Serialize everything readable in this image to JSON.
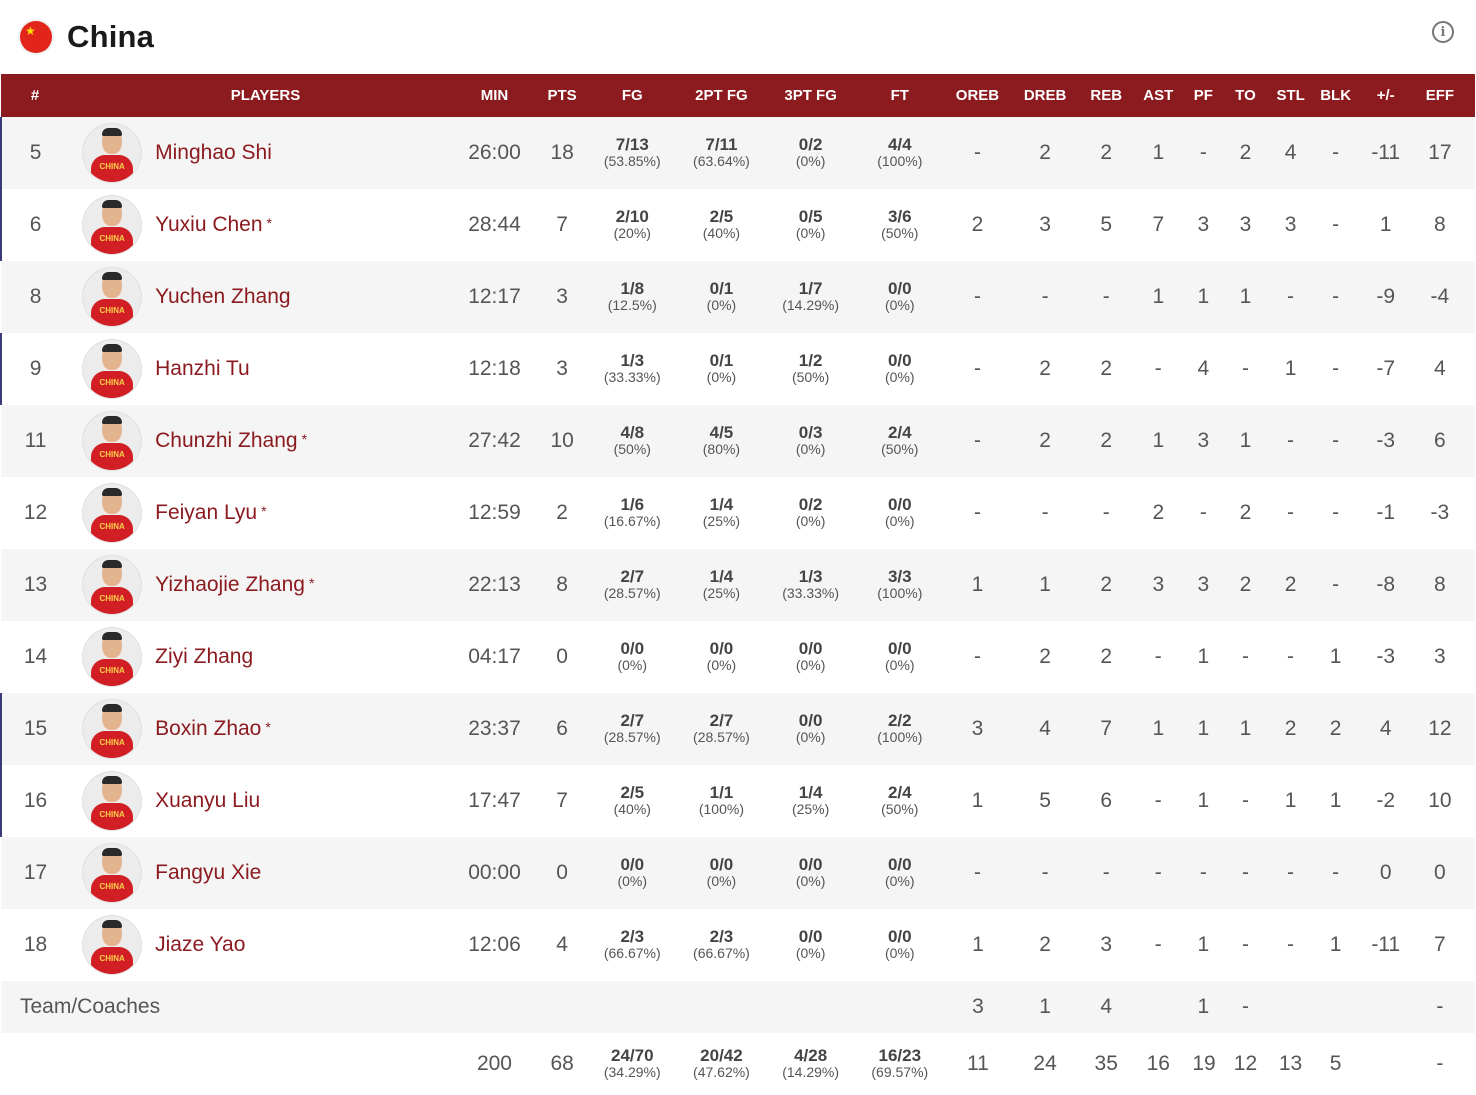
{
  "team": {
    "name": "China",
    "flag_icon": "china-flag-icon",
    "info_icon": "i"
  },
  "columns": [
    "#",
    "PLAYERS",
    "MIN",
    "PTS",
    "FG",
    "2PT FG",
    "3PT FG",
    "FT",
    "OREB",
    "DREB",
    "REB",
    "AST",
    "PF",
    "TO",
    "STL",
    "BLK",
    "+/-",
    "EFF"
  ],
  "players": [
    {
      "num": "5",
      "name": "Minghao Shi",
      "starter": false,
      "min": "26:00",
      "pts": "18",
      "fg": "7/13",
      "fg_pct": "(53.85%)",
      "fg2": "7/11",
      "fg2_pct": "(63.64%)",
      "fg3": "0/2",
      "fg3_pct": "(0%)",
      "ft": "4/4",
      "ft_pct": "(100%)",
      "oreb": "-",
      "dreb": "2",
      "reb": "2",
      "ast": "1",
      "pf": "-",
      "to": "2",
      "stl": "4",
      "blk": "-",
      "pm": "-11",
      "eff": "17"
    },
    {
      "num": "6",
      "name": "Yuxiu Chen",
      "starter": true,
      "min": "28:44",
      "pts": "7",
      "fg": "2/10",
      "fg_pct": "(20%)",
      "fg2": "2/5",
      "fg2_pct": "(40%)",
      "fg3": "0/5",
      "fg3_pct": "(0%)",
      "ft": "3/6",
      "ft_pct": "(50%)",
      "oreb": "2",
      "dreb": "3",
      "reb": "5",
      "ast": "7",
      "pf": "3",
      "to": "3",
      "stl": "3",
      "blk": "-",
      "pm": "1",
      "eff": "8"
    },
    {
      "num": "8",
      "name": "Yuchen Zhang",
      "starter": false,
      "min": "12:17",
      "pts": "3",
      "fg": "1/8",
      "fg_pct": "(12.5%)",
      "fg2": "0/1",
      "fg2_pct": "(0%)",
      "fg3": "1/7",
      "fg3_pct": "(14.29%)",
      "ft": "0/0",
      "ft_pct": "(0%)",
      "oreb": "-",
      "dreb": "-",
      "reb": "-",
      "ast": "1",
      "pf": "1",
      "to": "1",
      "stl": "-",
      "blk": "-",
      "pm": "-9",
      "eff": "-4"
    },
    {
      "num": "9",
      "name": "Hanzhi Tu",
      "starter": false,
      "min": "12:18",
      "pts": "3",
      "fg": "1/3",
      "fg_pct": "(33.33%)",
      "fg2": "0/1",
      "fg2_pct": "(0%)",
      "fg3": "1/2",
      "fg3_pct": "(50%)",
      "ft": "0/0",
      "ft_pct": "(0%)",
      "oreb": "-",
      "dreb": "2",
      "reb": "2",
      "ast": "-",
      "pf": "4",
      "to": "-",
      "stl": "1",
      "blk": "-",
      "pm": "-7",
      "eff": "4"
    },
    {
      "num": "11",
      "name": "Chunzhi Zhang",
      "starter": true,
      "min": "27:42",
      "pts": "10",
      "fg": "4/8",
      "fg_pct": "(50%)",
      "fg2": "4/5",
      "fg2_pct": "(80%)",
      "fg3": "0/3",
      "fg3_pct": "(0%)",
      "ft": "2/4",
      "ft_pct": "(50%)",
      "oreb": "-",
      "dreb": "2",
      "reb": "2",
      "ast": "1",
      "pf": "3",
      "to": "1",
      "stl": "-",
      "blk": "-",
      "pm": "-3",
      "eff": "6"
    },
    {
      "num": "12",
      "name": "Feiyan Lyu",
      "starter": true,
      "min": "12:59",
      "pts": "2",
      "fg": "1/6",
      "fg_pct": "(16.67%)",
      "fg2": "1/4",
      "fg2_pct": "(25%)",
      "fg3": "0/2",
      "fg3_pct": "(0%)",
      "ft": "0/0",
      "ft_pct": "(0%)",
      "oreb": "-",
      "dreb": "-",
      "reb": "-",
      "ast": "2",
      "pf": "-",
      "to": "2",
      "stl": "-",
      "blk": "-",
      "pm": "-1",
      "eff": "-3"
    },
    {
      "num": "13",
      "name": "Yizhaojie Zhang",
      "starter": true,
      "min": "22:13",
      "pts": "8",
      "fg": "2/7",
      "fg_pct": "(28.57%)",
      "fg2": "1/4",
      "fg2_pct": "(25%)",
      "fg3": "1/3",
      "fg3_pct": "(33.33%)",
      "ft": "3/3",
      "ft_pct": "(100%)",
      "oreb": "1",
      "dreb": "1",
      "reb": "2",
      "ast": "3",
      "pf": "3",
      "to": "2",
      "stl": "2",
      "blk": "-",
      "pm": "-8",
      "eff": "8"
    },
    {
      "num": "14",
      "name": "Ziyi Zhang",
      "starter": false,
      "min": "04:17",
      "pts": "0",
      "fg": "0/0",
      "fg_pct": "(0%)",
      "fg2": "0/0",
      "fg2_pct": "(0%)",
      "fg3": "0/0",
      "fg3_pct": "(0%)",
      "ft": "0/0",
      "ft_pct": "(0%)",
      "oreb": "-",
      "dreb": "2",
      "reb": "2",
      "ast": "-",
      "pf": "1",
      "to": "-",
      "stl": "-",
      "blk": "1",
      "pm": "-3",
      "eff": "3"
    },
    {
      "num": "15",
      "name": "Boxin Zhao",
      "starter": true,
      "min": "23:37",
      "pts": "6",
      "fg": "2/7",
      "fg_pct": "(28.57%)",
      "fg2": "2/7",
      "fg2_pct": "(28.57%)",
      "fg3": "0/0",
      "fg3_pct": "(0%)",
      "ft": "2/2",
      "ft_pct": "(100%)",
      "oreb": "3",
      "dreb": "4",
      "reb": "7",
      "ast": "1",
      "pf": "1",
      "to": "1",
      "stl": "2",
      "blk": "2",
      "pm": "4",
      "eff": "12"
    },
    {
      "num": "16",
      "name": "Xuanyu Liu",
      "starter": false,
      "min": "17:47",
      "pts": "7",
      "fg": "2/5",
      "fg_pct": "(40%)",
      "fg2": "1/1",
      "fg2_pct": "(100%)",
      "fg3": "1/4",
      "fg3_pct": "(25%)",
      "ft": "2/4",
      "ft_pct": "(50%)",
      "oreb": "1",
      "dreb": "5",
      "reb": "6",
      "ast": "-",
      "pf": "1",
      "to": "-",
      "stl": "1",
      "blk": "1",
      "pm": "-2",
      "eff": "10"
    },
    {
      "num": "17",
      "name": "Fangyu Xie",
      "starter": false,
      "min": "00:00",
      "pts": "0",
      "fg": "0/0",
      "fg_pct": "(0%)",
      "fg2": "0/0",
      "fg2_pct": "(0%)",
      "fg3": "0/0",
      "fg3_pct": "(0%)",
      "ft": "0/0",
      "ft_pct": "(0%)",
      "oreb": "-",
      "dreb": "-",
      "reb": "-",
      "ast": "-",
      "pf": "-",
      "to": "-",
      "stl": "-",
      "blk": "-",
      "pm": "0",
      "eff": "0"
    },
    {
      "num": "18",
      "name": "Jiaze Yao",
      "starter": false,
      "min": "12:06",
      "pts": "4",
      "fg": "2/3",
      "fg_pct": "(66.67%)",
      "fg2": "2/3",
      "fg2_pct": "(66.67%)",
      "fg3": "0/0",
      "fg3_pct": "(0%)",
      "ft": "0/0",
      "ft_pct": "(0%)",
      "oreb": "1",
      "dreb": "2",
      "reb": "3",
      "ast": "-",
      "pf": "1",
      "to": "-",
      "stl": "-",
      "blk": "1",
      "pm": "-11",
      "eff": "7"
    }
  ],
  "oncourt_marker_rows": [
    "5",
    "6",
    "9",
    "15",
    "16"
  ],
  "team_coaches": {
    "label": "Team/Coaches",
    "oreb": "3",
    "dreb": "1",
    "reb": "4",
    "ast": "",
    "pf": "1",
    "to": "-",
    "stl": "",
    "blk": "",
    "pm": "",
    "eff": "-"
  },
  "totals": {
    "min": "200",
    "pts": "68",
    "fg": "24/70",
    "fg_pct": "(34.29%)",
    "fg2": "20/42",
    "fg2_pct": "(47.62%)",
    "fg3": "4/28",
    "fg3_pct": "(14.29%)",
    "ft": "16/23",
    "ft_pct": "(69.57%)",
    "oreb": "11",
    "dreb": "24",
    "reb": "35",
    "ast": "16",
    "pf": "19",
    "to": "12",
    "stl": "13",
    "blk": "5",
    "pm": "",
    "eff": "-"
  },
  "colors": {
    "header_bg": "#8c1b20",
    "player_name": "#8c1b20",
    "row_alt": "#f5f5f5",
    "oncourt_marker": "#3b3b78",
    "flag": "#e1251b"
  },
  "jersey_text": "CHINA"
}
